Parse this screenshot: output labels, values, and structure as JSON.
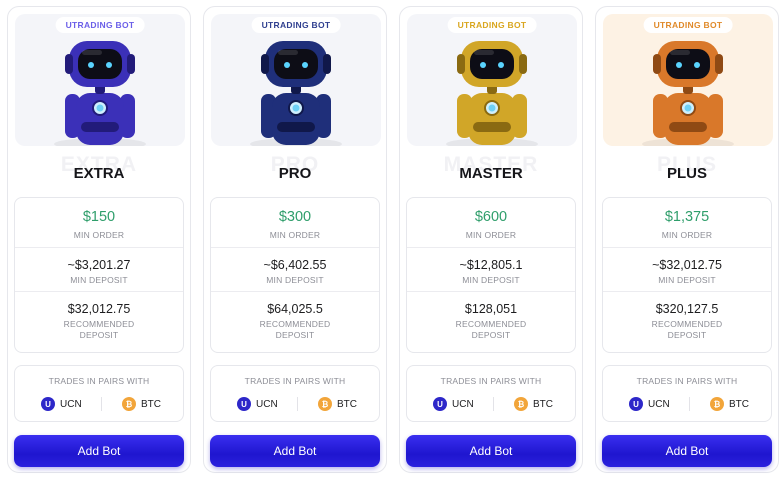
{
  "plans": [
    {
      "badge": "UTRADING BOT",
      "badge_color": "#6b5fe8",
      "hero_bg": "#f4f5f9",
      "robot_color": "#3b30b8",
      "robot_dark": "#221b7a",
      "ghost_name": "EXTRA",
      "name": "EXTRA",
      "min_order_value": "$150",
      "min_order_label": "MIN ORDER",
      "min_deposit_value": "~$3,201.27",
      "min_deposit_label": "MIN DEPOSIT",
      "recommended_value": "$32,012.75",
      "recommended_label": "RECOMMENDED DEPOSIT",
      "pairs_title": "TRADES IN PAIRS WITH",
      "pair_1": "UCN",
      "pair_2": "BTC",
      "button": "Add Bot"
    },
    {
      "badge": "UTRADING BOT",
      "badge_color": "#2f3f8f",
      "hero_bg": "#f4f5f9",
      "robot_color": "#1f2f7a",
      "robot_dark": "#10184a",
      "ghost_name": "PRO",
      "name": "PRO",
      "min_order_value": "$300",
      "min_order_label": "MIN ORDER",
      "min_deposit_value": "~$6,402.55",
      "min_deposit_label": "MIN DEPOSIT",
      "recommended_value": "$64,025.5",
      "recommended_label": "RECOMMENDED DEPOSIT",
      "pairs_title": "TRADES IN PAIRS WITH",
      "pair_1": "UCN",
      "pair_2": "BTC",
      "button": "Add Bot"
    },
    {
      "badge": "UTRADING BOT",
      "badge_color": "#d9a61f",
      "hero_bg": "#f4f5f9",
      "robot_color": "#d1a628",
      "robot_dark": "#8a6a12",
      "ghost_name": "MASTER",
      "name": "MASTER",
      "min_order_value": "$600",
      "min_order_label": "MIN ORDER",
      "min_deposit_value": "~$12,805.1",
      "min_deposit_label": "MIN DEPOSIT",
      "recommended_value": "$128,051",
      "recommended_label": "RECOMMENDED DEPOSIT",
      "pairs_title": "TRADES IN PAIRS WITH",
      "pair_1": "UCN",
      "pair_2": "BTC",
      "button": "Add Bot"
    },
    {
      "badge": "UTRADING BOT",
      "badge_color": "#e08a2a",
      "hero_bg": "#fdf2e4",
      "robot_color": "#d9782a",
      "robot_dark": "#8f4a14",
      "ghost_name": "PLUS",
      "name": "PLUS",
      "min_order_value": "$1,375",
      "min_order_label": "MIN ORDER",
      "min_deposit_value": "~$32,012.75",
      "min_deposit_label": "MIN DEPOSIT",
      "recommended_value": "$320,127.5",
      "recommended_label": "RECOMMENDED DEPOSIT",
      "pairs_title": "TRADES IN PAIRS WITH",
      "pair_1": "UCN",
      "pair_2": "BTC",
      "button": "Add Bot"
    }
  ],
  "icons": {
    "pair_1_icon": "ucn-coin-icon",
    "pair_2_icon": "btc-coin-icon",
    "robot": "robot-mascot-icon"
  },
  "colors": {
    "price_green": "#2f9e6b",
    "button_blue": "#2a20de",
    "ucn_blue": "#2d27c9",
    "btc_orange": "#f2a53a"
  }
}
